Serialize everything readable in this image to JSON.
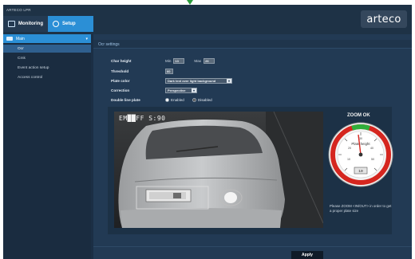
{
  "app": {
    "title": "ARTECO LPR",
    "brand": "arteco"
  },
  "tabs": [
    {
      "label": "Monitoring",
      "active": false,
      "icon": "monitor-icon"
    },
    {
      "label": "Setup",
      "active": true,
      "icon": "gear-icon"
    }
  ],
  "sidebar": {
    "header": {
      "label": "Main",
      "icon": "camera-icon"
    },
    "items": [
      {
        "label": "Ocr",
        "active": true
      },
      {
        "label": "Cmk",
        "active": false
      },
      {
        "label": "Event action setup",
        "active": false
      },
      {
        "label": "Access control",
        "active": false
      }
    ]
  },
  "section": {
    "title": "Ocr settings"
  },
  "form": {
    "char_height": {
      "label": "Char height",
      "min_label": "Min",
      "min_value": "13",
      "max_label": "Max",
      "max_value": "26"
    },
    "threshold": {
      "label": "Threshold",
      "value": "60"
    },
    "plate_color": {
      "label": "Plate color",
      "value": "Dark text over light background"
    },
    "correction": {
      "label": "Correction",
      "value": "Perspective"
    },
    "double_line": {
      "label": "Double line plate",
      "options": [
        "Enabled",
        "Disabled"
      ],
      "selected": "Disabled"
    }
  },
  "camera": {
    "overlay_text": "EM██FF S:90"
  },
  "zoom": {
    "title": "ZOOM OK",
    "gauge_label": "Plate height",
    "gauge_ticks": [
      "10",
      "20",
      "30",
      "40",
      "50"
    ],
    "gauge_value_readout": "10",
    "note": "Please ZOOM <IN/OUT> in order to get a proper plate size",
    "colors": {
      "ok": "#2fae3a",
      "warn": "#d5261f"
    }
  },
  "footer": {
    "apply_label": "Apply"
  }
}
